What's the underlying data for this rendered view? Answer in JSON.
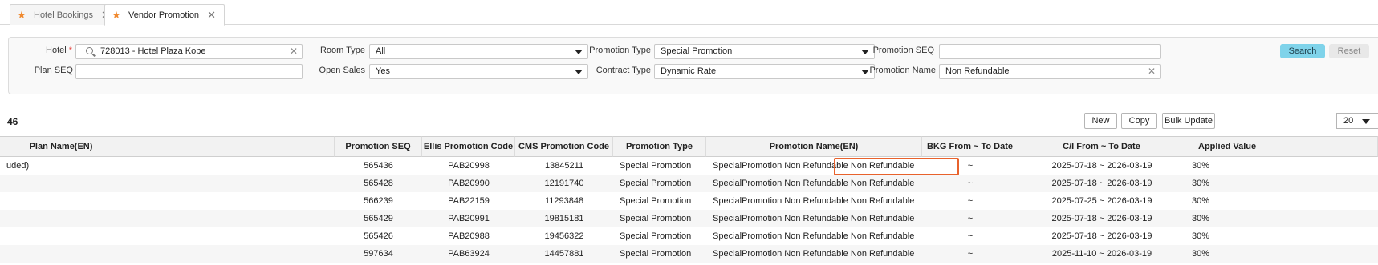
{
  "tabs": [
    {
      "label": "Hotel Bookings",
      "icon": "star-icon"
    },
    {
      "label": "Vendor Promotion",
      "icon": "star-icon"
    }
  ],
  "filters": {
    "hotel_label": "Hotel",
    "hotel_value": "728013 - Hotel Plaza Kobe",
    "plan_seq_label": "Plan SEQ",
    "plan_seq_value": "",
    "room_type_label": "Room Type",
    "room_type_value": "All",
    "open_sales_label": "Open Sales",
    "open_sales_value": "Yes",
    "promotion_type_label": "Promotion Type",
    "promotion_type_value": "Special Promotion",
    "contract_type_label": "Contract Type",
    "contract_type_value": "Dynamic Rate",
    "promotion_seq_label": "Promotion SEQ",
    "promotion_seq_value": "",
    "promotion_name_label": "Promotion Name",
    "promotion_name_value": "Non Refundable",
    "search_label": "Search",
    "reset_label": "Reset"
  },
  "results": {
    "count": "46",
    "new_label": "New",
    "copy_label": "Copy",
    "bulk_update_label": "Bulk Update",
    "page_size": "20"
  },
  "table": {
    "headers": {
      "plan_name": "Plan Name(EN)",
      "promotion_seq": "Promotion SEQ",
      "ellis_code": "Ellis Promotion Code",
      "cms_code": "CMS Promotion Code",
      "promotion_type": "Promotion Type",
      "promotion_name": "Promotion Name(EN)",
      "bkg_dates": "BKG From ~ To Date",
      "ci_dates": "C/I From ~ To Date",
      "applied_value": "Applied Value"
    },
    "rows": [
      {
        "plan_name": "uded)",
        "promotion_seq": "565436",
        "ellis_code": "PAB20998",
        "cms_code": "13845211",
        "promotion_type": "Special Promotion",
        "promotion_name": "SpecialPromotion Non Refundable Non Refundable",
        "bkg_dates": "~",
        "ci_dates": "2025-07-18 ~ 2026-03-19",
        "applied_value": "30%"
      },
      {
        "plan_name": "",
        "promotion_seq": "565428",
        "ellis_code": "PAB20990",
        "cms_code": "12191740",
        "promotion_type": "Special Promotion",
        "promotion_name": "SpecialPromotion Non Refundable Non Refundable",
        "bkg_dates": "~",
        "ci_dates": "2025-07-18 ~ 2026-03-19",
        "applied_value": "30%"
      },
      {
        "plan_name": "",
        "promotion_seq": "566239",
        "ellis_code": "PAB22159",
        "cms_code": "11293848",
        "promotion_type": "Special Promotion",
        "promotion_name": "SpecialPromotion Non Refundable Non Refundable",
        "bkg_dates": "~",
        "ci_dates": "2025-07-25 ~ 2026-03-19",
        "applied_value": "30%"
      },
      {
        "plan_name": "",
        "promotion_seq": "565429",
        "ellis_code": "PAB20991",
        "cms_code": "19815181",
        "promotion_type": "Special Promotion",
        "promotion_name": "SpecialPromotion Non Refundable Non Refundable",
        "bkg_dates": "~",
        "ci_dates": "2025-07-18 ~ 2026-03-19",
        "applied_value": "30%"
      },
      {
        "plan_name": "",
        "promotion_seq": "565426",
        "ellis_code": "PAB20988",
        "cms_code": "19456322",
        "promotion_type": "Special Promotion",
        "promotion_name": "SpecialPromotion Non Refundable Non Refundable",
        "bkg_dates": "~",
        "ci_dates": "2025-07-18 ~ 2026-03-19",
        "applied_value": "30%"
      },
      {
        "plan_name": "",
        "promotion_seq": "597634",
        "ellis_code": "PAB63924",
        "cms_code": "14457881",
        "promotion_type": "Special Promotion",
        "promotion_name": "SpecialPromotion Non Refundable Non Refundable",
        "bkg_dates": "~",
        "ci_dates": "2025-11-10 ~ 2026-03-19",
        "applied_value": "30%"
      }
    ]
  },
  "colors": {
    "accent_star": "#f08a30",
    "search_button": "#7fd3ea",
    "highlight_border": "#e8622c",
    "required_mark": "#e53935"
  }
}
